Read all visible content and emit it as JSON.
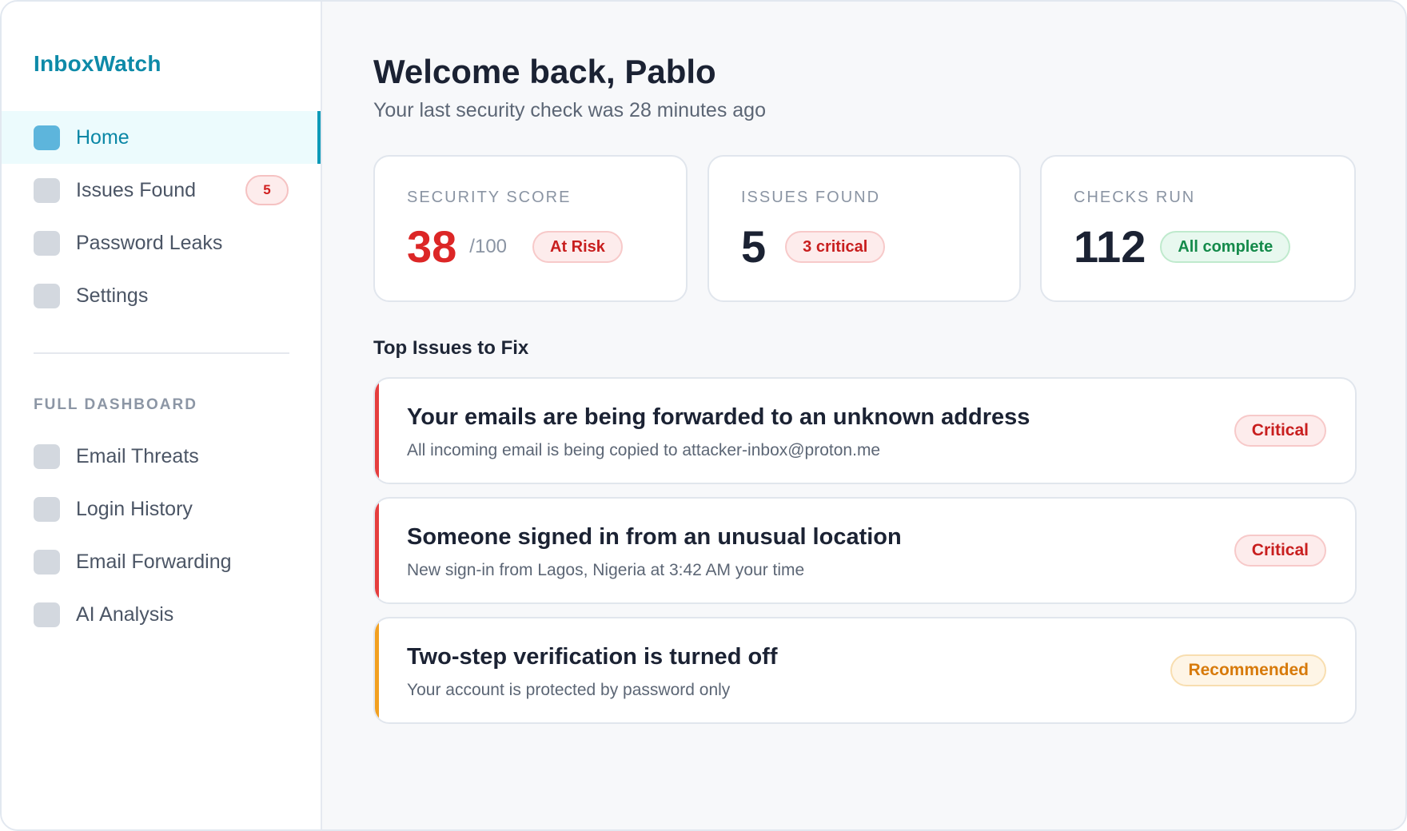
{
  "app": {
    "name": "InboxWatch"
  },
  "sidebar": {
    "items": [
      {
        "label": "Home",
        "active": true,
        "icon": "home-icon"
      },
      {
        "label": "Issues Found",
        "badge": "5",
        "icon": "issues-icon"
      },
      {
        "label": "Password Leaks",
        "icon": "password-icon"
      },
      {
        "label": "Settings",
        "icon": "settings-icon"
      }
    ],
    "section_label": "FULL DASHBOARD",
    "dashboard_items": [
      {
        "label": "Email Threats",
        "icon": "threats-icon"
      },
      {
        "label": "Login History",
        "icon": "history-icon"
      },
      {
        "label": "Email Forwarding",
        "icon": "forwarding-icon"
      },
      {
        "label": "AI Analysis",
        "icon": "ai-icon"
      }
    ]
  },
  "header": {
    "welcome": "Welcome back, Pablo",
    "subtitle": "Your last security check was 28 minutes ago"
  },
  "stats": [
    {
      "title": "SECURITY SCORE",
      "value": "38",
      "suffix": "/100",
      "pill": "At Risk",
      "pill_color": "#c81e1e"
    },
    {
      "title": "ISSUES FOUND",
      "value": "5",
      "pill": "3 critical",
      "pill_color": "#c81e1e"
    },
    {
      "title": "CHECKS RUN",
      "value": "112",
      "pill": "All complete",
      "pill_color": "#148a4a"
    }
  ],
  "top_issues": {
    "heading": "Top Issues to Fix",
    "items": [
      {
        "title": "Your emails are being forwarded to an unknown address",
        "description": "All incoming email is being copied to attacker-inbox@proton.me",
        "severity": "Critical",
        "color": "#e53e3e"
      },
      {
        "title": "Someone signed in from an unusual location",
        "description": "New sign-in from Lagos, Nigeria at 3:42 AM your time",
        "severity": "Critical",
        "color": "#e53e3e"
      },
      {
        "title": "Two-step verification is turned off",
        "description": "Your account is protected by password only",
        "severity": "Recommended",
        "color": "#f2a020"
      }
    ]
  },
  "colors": {
    "brand": "#0e8aa8",
    "critical": "#dc2626",
    "success": "#148a4a",
    "warning": "#d77a0a"
  }
}
